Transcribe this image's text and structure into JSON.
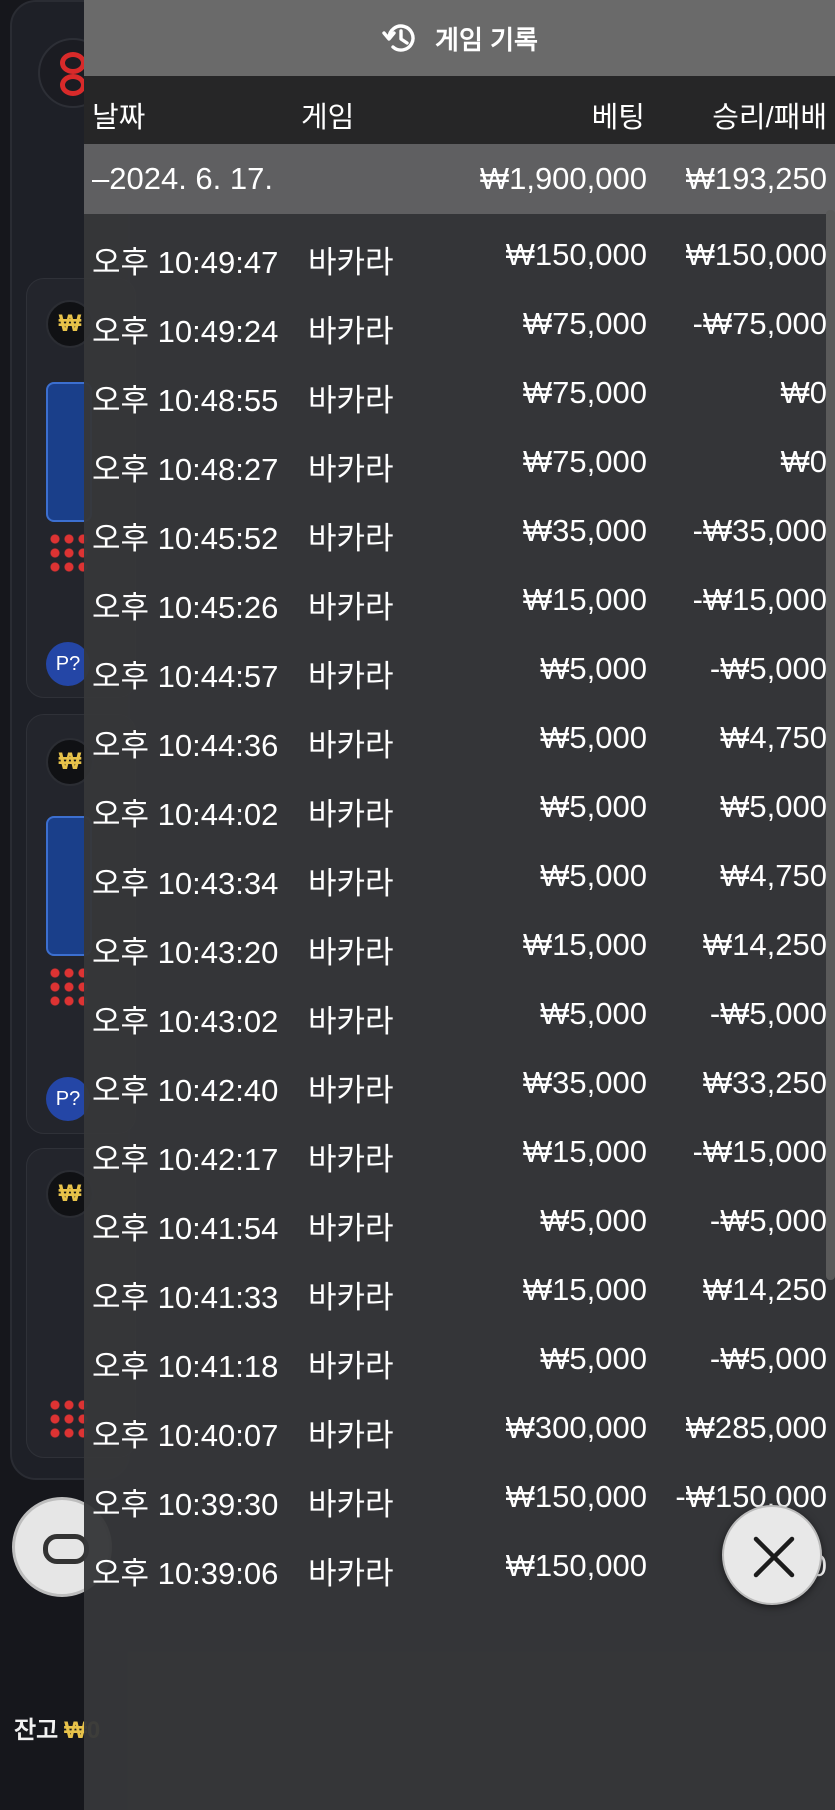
{
  "header": {
    "title": "게임 기록",
    "icon": "history-icon"
  },
  "columns": {
    "date": "날짜",
    "game": "게임",
    "bet": "베팅",
    "result": "승리/패배"
  },
  "day_summary": {
    "label": "–2024. 6. 17.",
    "bet": "₩1,900,000",
    "result": "₩193,250"
  },
  "rows": [
    {
      "time": "오후 10:49:47",
      "game": "바카라",
      "bet": "₩150,000",
      "result": "₩150,000"
    },
    {
      "time": "오후 10:49:24",
      "game": "바카라",
      "bet": "₩75,000",
      "result": "-₩75,000"
    },
    {
      "time": "오후 10:48:55",
      "game": "바카라",
      "bet": "₩75,000",
      "result": "₩0"
    },
    {
      "time": "오후 10:48:27",
      "game": "바카라",
      "bet": "₩75,000",
      "result": "₩0"
    },
    {
      "time": "오후 10:45:52",
      "game": "바카라",
      "bet": "₩35,000",
      "result": "-₩35,000"
    },
    {
      "time": "오후 10:45:26",
      "game": "바카라",
      "bet": "₩15,000",
      "result": "-₩15,000"
    },
    {
      "time": "오후 10:44:57",
      "game": "바카라",
      "bet": "₩5,000",
      "result": "-₩5,000"
    },
    {
      "time": "오후 10:44:36",
      "game": "바카라",
      "bet": "₩5,000",
      "result": "₩4,750"
    },
    {
      "time": "오후 10:44:02",
      "game": "바카라",
      "bet": "₩5,000",
      "result": "₩5,000"
    },
    {
      "time": "오후 10:43:34",
      "game": "바카라",
      "bet": "₩5,000",
      "result": "₩4,750"
    },
    {
      "time": "오후 10:43:20",
      "game": "바카라",
      "bet": "₩15,000",
      "result": "₩14,250"
    },
    {
      "time": "오후 10:43:02",
      "game": "바카라",
      "bet": "₩5,000",
      "result": "-₩5,000"
    },
    {
      "time": "오후 10:42:40",
      "game": "바카라",
      "bet": "₩35,000",
      "result": "₩33,250"
    },
    {
      "time": "오후 10:42:17",
      "game": "바카라",
      "bet": "₩15,000",
      "result": "-₩15,000"
    },
    {
      "time": "오후 10:41:54",
      "game": "바카라",
      "bet": "₩5,000",
      "result": "-₩5,000"
    },
    {
      "time": "오후 10:41:33",
      "game": "바카라",
      "bet": "₩15,000",
      "result": "₩14,250"
    },
    {
      "time": "오후 10:41:18",
      "game": "바카라",
      "bet": "₩5,000",
      "result": "-₩5,000"
    },
    {
      "time": "오후 10:40:07",
      "game": "바카라",
      "bet": "₩300,000",
      "result": "₩285,000"
    },
    {
      "time": "오후 10:39:30",
      "game": "바카라",
      "bet": "₩150,000",
      "result": "-₩150,000"
    },
    {
      "time": "오후 10:39:06",
      "game": "바카라",
      "bet": "₩150,000",
      "result": "₩0"
    }
  ],
  "background": {
    "balance_label": "잔고",
    "balance_value": "₩0",
    "chip_symbol": "₩",
    "bubble_label": "P?"
  },
  "close_icon": "close-icon",
  "colors": {
    "header_bg": "#6a6a6a",
    "column_header_bg": "#262627",
    "summary_bg": "#5f5f61",
    "panel_bg": "#363739",
    "accent_gold": "#e7c24a"
  }
}
